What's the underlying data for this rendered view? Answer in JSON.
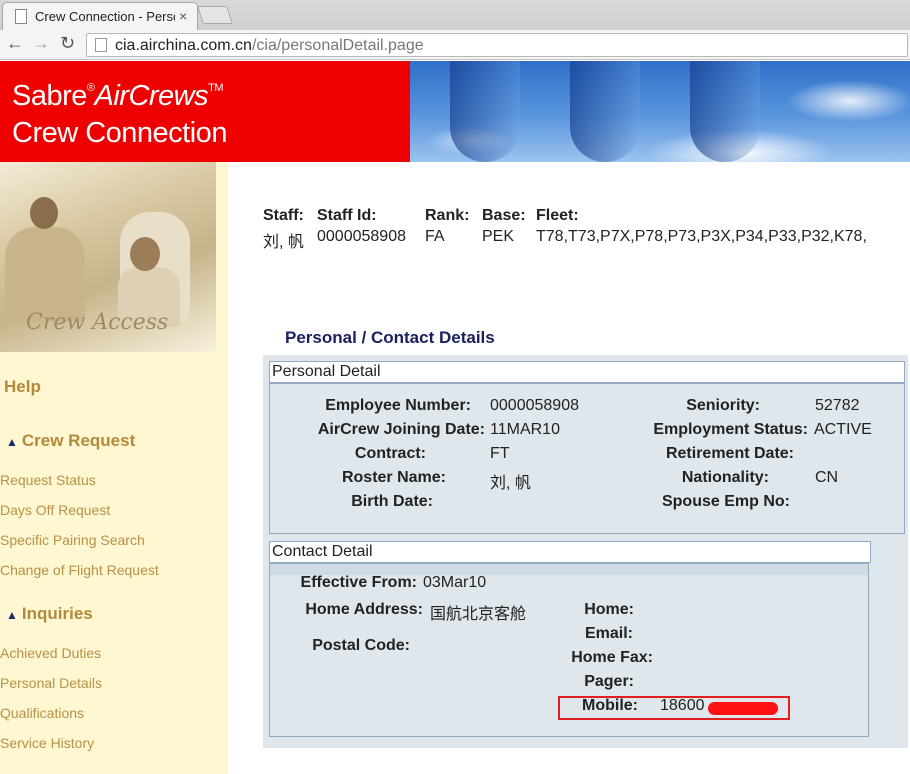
{
  "browser": {
    "tab_title": "Crew Connection - Persona",
    "tab_close": "×",
    "url_host": "cia.airchina.com.cn",
    "url_path": "/cia/personalDetail.page"
  },
  "banner": {
    "brand_sabre": "Sabre",
    "brand_reg": "®",
    "brand_aircrews": "AirCrews",
    "brand_tm": "TM",
    "brand_line2": "Crew Connection"
  },
  "sidebar": {
    "photo_caption": "Crew Access",
    "help": "Help",
    "crew_request": {
      "heading": "Crew Request",
      "items": [
        "Request Status",
        "Days Off Request",
        "Specific Pairing Search",
        "Change of Flight Request"
      ]
    },
    "inquiries": {
      "heading": "Inquiries",
      "items": [
        "Achieved Duties",
        "Personal Details",
        "Qualifications",
        "Service History"
      ]
    }
  },
  "staff": {
    "staff_label": "Staff:",
    "staff_value": "刘, 帆",
    "staff_id_label": "Staff Id:",
    "staff_id_value": "0000058908",
    "rank_label": "Rank:",
    "rank_value": "FA",
    "base_label": "Base:",
    "base_value": "PEK",
    "fleet_label": "Fleet:",
    "fleet_value": "T78,T73,P7X,P78,P73,P3X,P34,P33,P32,K78,"
  },
  "section_title": "Personal / Contact Details",
  "personal_detail": {
    "title": "Personal Detail",
    "employee_number_label": "Employee Number:",
    "employee_number": "0000058908",
    "joining_date_label": "AirCrew Joining Date:",
    "joining_date": "11MAR10",
    "contract_label": "Contract:",
    "contract": "FT",
    "roster_name_label": "Roster Name:",
    "roster_name": "刘, 帆",
    "birth_date_label": "Birth Date:",
    "seniority_label": "Seniority:",
    "seniority": "52782",
    "employment_status_label": "Employment Status:",
    "employment_status": "ACTIVE",
    "retirement_date_label": "Retirement Date:",
    "nationality_label": "Nationality:",
    "nationality": "CN",
    "spouse_emp_label": "Spouse Emp No:"
  },
  "contact_detail": {
    "title": "Contact Detail",
    "effective_from_label": "Effective From:",
    "effective_from": "03Mar10",
    "home_address_label": "Home Address:",
    "home_address": "国航北京客舱",
    "postal_code_label": "Postal Code:",
    "home_label": "Home:",
    "email_label": "Email:",
    "home_fax_label": "Home Fax:",
    "pager_label": "Pager:",
    "mobile_label": "Mobile:",
    "mobile": "18600"
  },
  "colors": {
    "banner_red": "#ee0000",
    "sidebar_bg": "#fff7d2",
    "sidebar_link": "#b89145",
    "section_title": "#1a2160",
    "panel_bg": "#dfe7ec",
    "highlight_red": "#e02020"
  }
}
